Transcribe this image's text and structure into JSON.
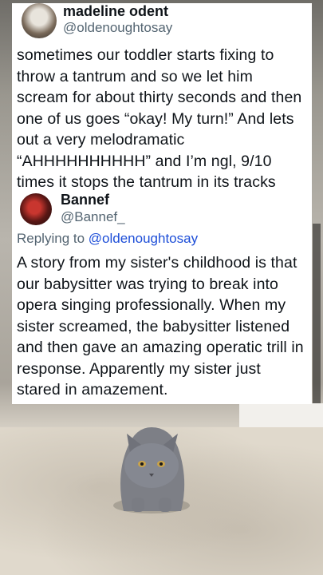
{
  "tweet1": {
    "name": "madeline odent",
    "handle": "@oldenoughtosay",
    "body": "sometimes our toddler starts fixing to throw a tantrum and so we let him scream for about thirty seconds and then one of us goes “okay! My turn!” And lets out a very melodramatic “AHHHHHHHHHH” and I’m ngl, 9/10 times it stops the tantrum in its tracks"
  },
  "tweet2": {
    "name": "Bannef",
    "handle": "@Bannef_",
    "replying_prefix": "Replying to ",
    "replying_to": "@oldenoughtosay",
    "body": "A story from my sister's childhood is that our babysitter was trying to break into opera singing professionally. When my sister screamed, the babysitter listened and then gave an amazing operatic trill in response. Apparently my sister just stared in amazement."
  },
  "colors": {
    "card_bg": "#ffffff",
    "text": "#0f1419",
    "secondary": "#536471",
    "link": "#1d4ed8"
  }
}
